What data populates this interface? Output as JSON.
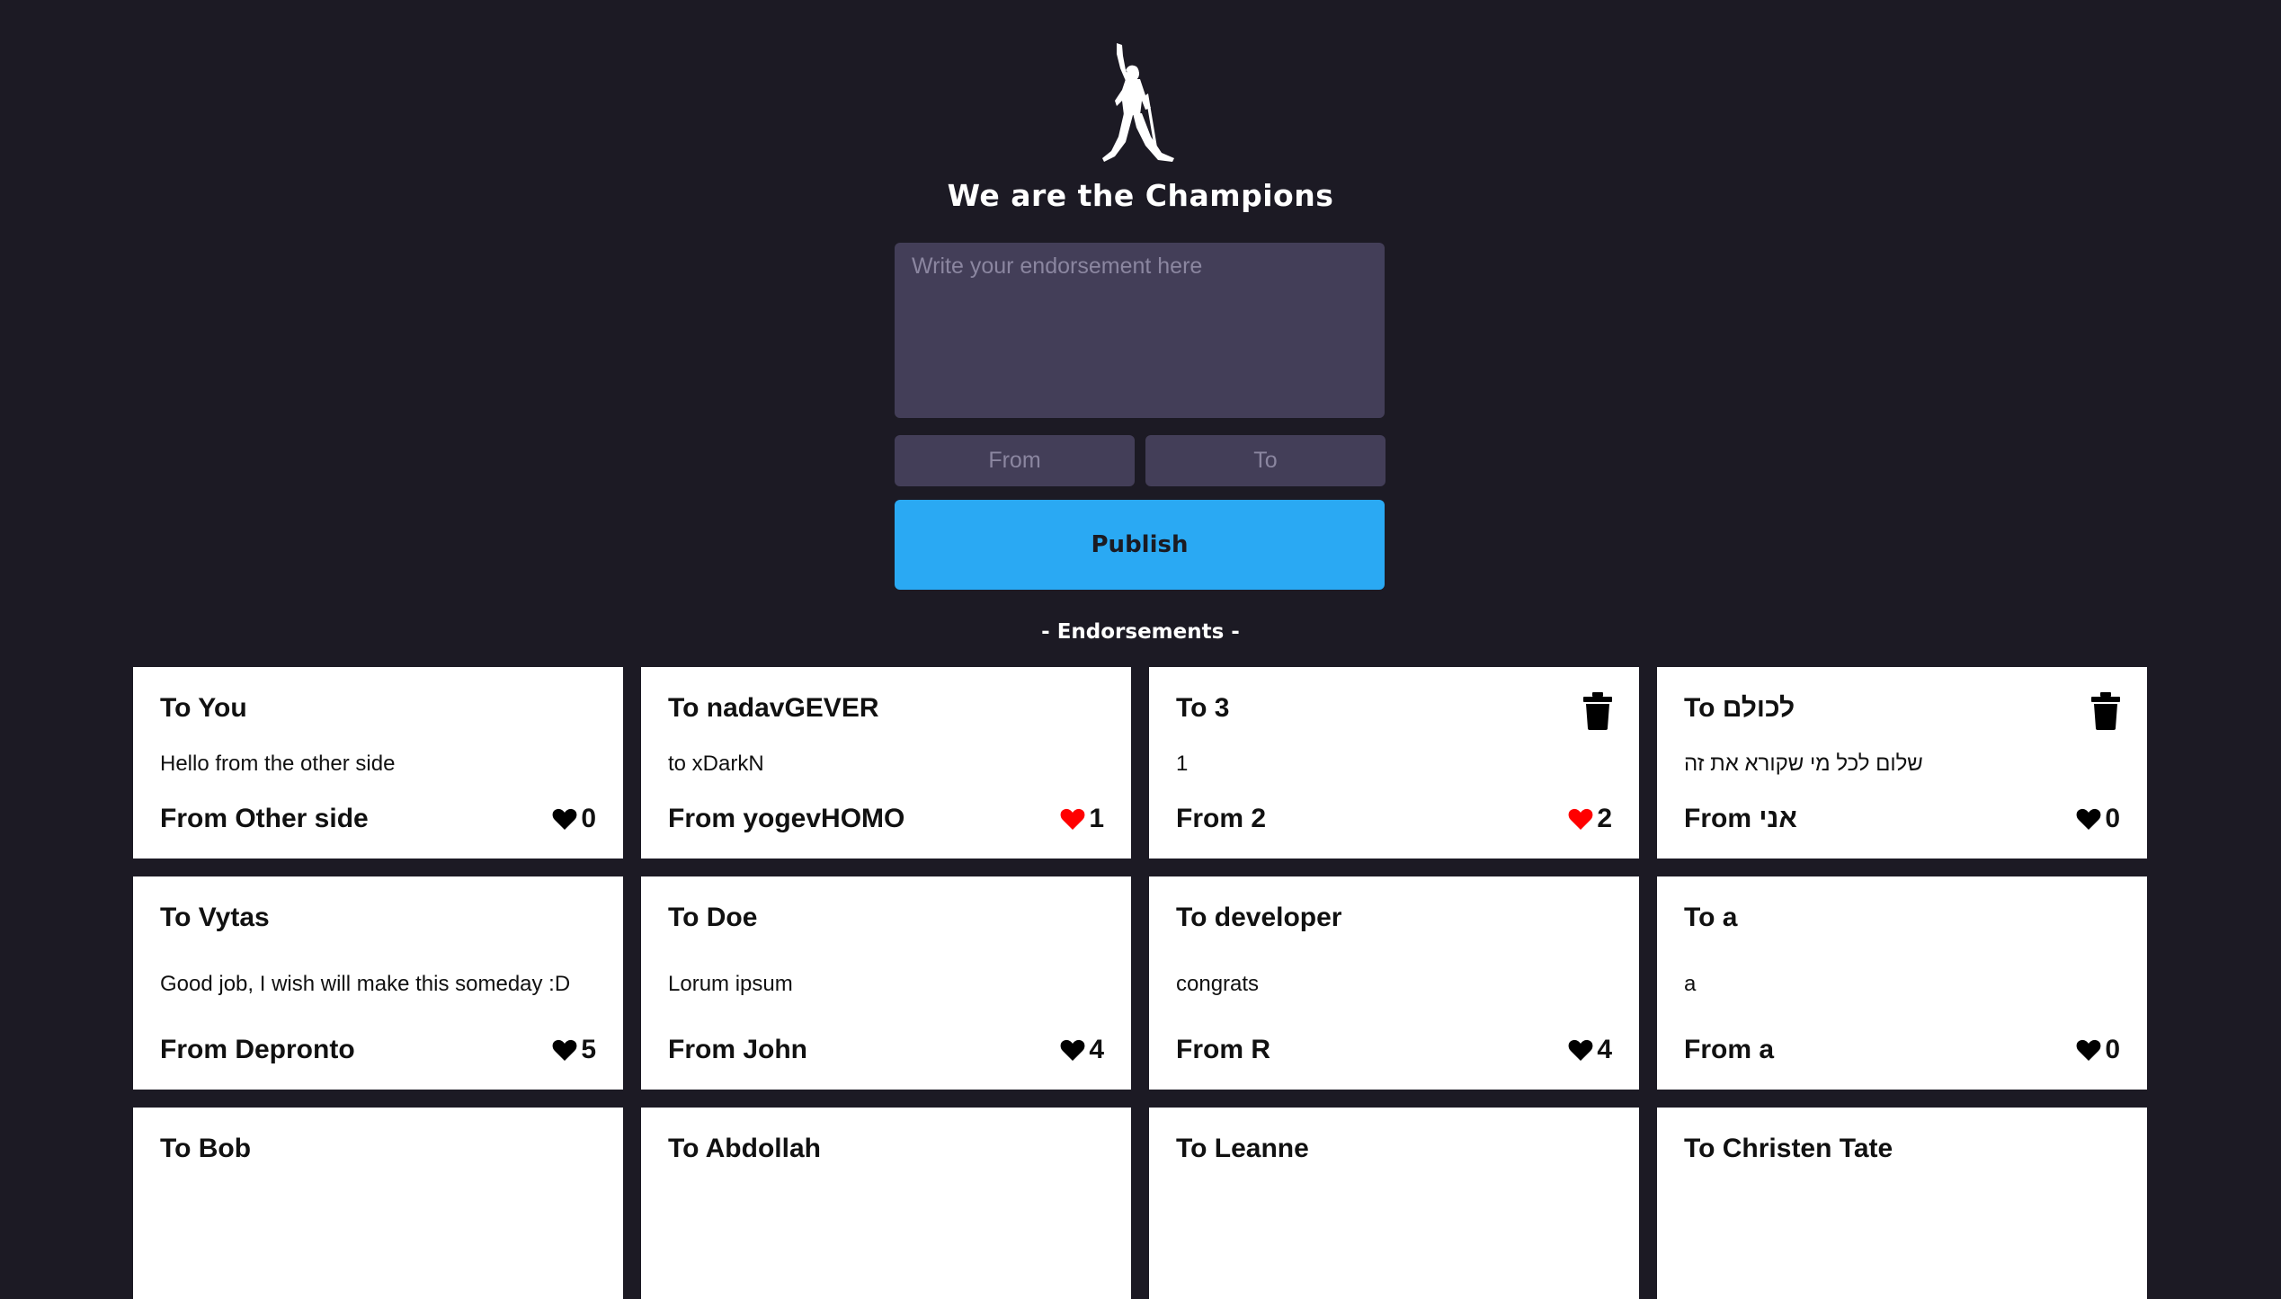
{
  "header": {
    "logo_icon": "freddie-mercury-silhouette-icon",
    "title": "We are the Champions"
  },
  "form": {
    "endorsement_placeholder": "Write your endorsement here",
    "from_placeholder": "From",
    "to_placeholder": "To",
    "publish_label": "Publish"
  },
  "section_title": "- Endorsements -",
  "colors": {
    "background": "#1c1a24",
    "input_bg": "#433e58",
    "accent": "#2aa9f3",
    "liked_heart": "#ff0000",
    "unliked_heart": "#000000"
  },
  "endorsements": [
    {
      "to": "To You",
      "message": "Hello from the other side",
      "from": "From Other side",
      "likes": "0",
      "liked": false,
      "deletable": false,
      "rtl": false
    },
    {
      "to": "To nadavGEVER",
      "message": "to xDarkN",
      "from": "From yogevHOMO",
      "likes": "1",
      "liked": true,
      "deletable": false,
      "rtl": false
    },
    {
      "to": "To 3",
      "message": "1",
      "from": "From 2",
      "likes": "2",
      "liked": true,
      "deletable": true,
      "rtl": false
    },
    {
      "to": "To לכולם",
      "message": "שלום לכל מי שקורא את זה",
      "from": "From אני",
      "likes": "0",
      "liked": false,
      "deletable": true,
      "rtl": true
    },
    {
      "to": "To Vytas",
      "message": "Good job, I wish will make this someday :D",
      "from": "From Depronto",
      "likes": "5",
      "liked": false,
      "deletable": false,
      "rtl": false
    },
    {
      "to": "To Doe",
      "message": "Lorum ipsum",
      "from": "From John",
      "likes": "4",
      "liked": false,
      "deletable": false,
      "rtl": false
    },
    {
      "to": "To developer",
      "message": "congrats",
      "from": "From R",
      "likes": "4",
      "liked": false,
      "deletable": false,
      "rtl": false
    },
    {
      "to": "To a",
      "message": "a",
      "from": "From a",
      "likes": "0",
      "liked": false,
      "deletable": false,
      "rtl": false
    },
    {
      "to": "To Bob",
      "message": "",
      "from": "",
      "likes": "",
      "liked": false,
      "deletable": false,
      "rtl": false
    },
    {
      "to": "To Abdollah",
      "message": "",
      "from": "",
      "likes": "",
      "liked": false,
      "deletable": false,
      "rtl": false
    },
    {
      "to": "To Leanne",
      "message": "",
      "from": "",
      "likes": "",
      "liked": false,
      "deletable": false,
      "rtl": false
    },
    {
      "to": "To Christen Tate",
      "message": "",
      "from": "",
      "likes": "",
      "liked": false,
      "deletable": false,
      "rtl": false
    }
  ]
}
